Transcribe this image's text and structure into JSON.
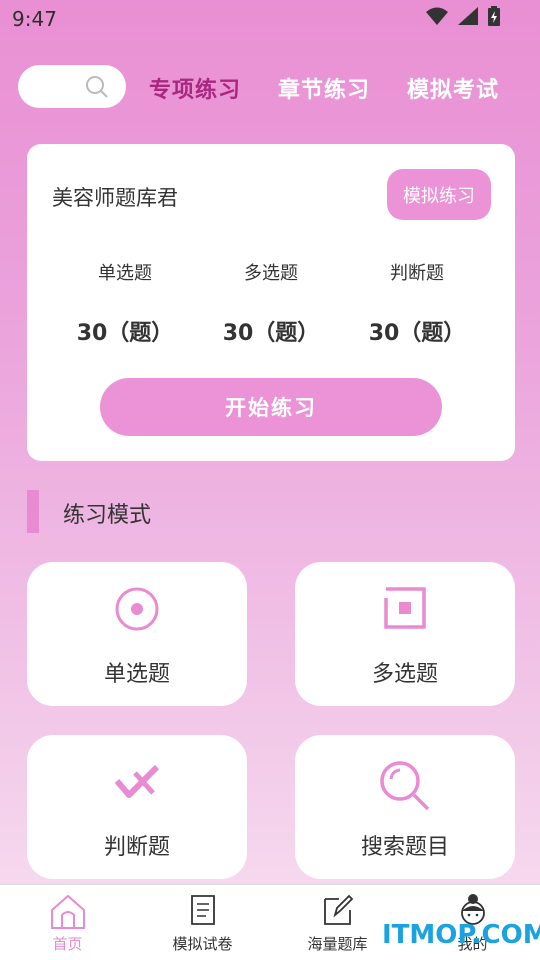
{
  "status_bar": {
    "time": "9:47"
  },
  "search": {
    "icon": "search-icon"
  },
  "top_tabs": [
    {
      "label": "专项练习",
      "active": true
    },
    {
      "label": "章节练习",
      "active": false
    },
    {
      "label": "模拟考试",
      "active": false
    }
  ],
  "card": {
    "title": "美容师题库君",
    "mock_button": "模拟练习",
    "stats": [
      {
        "label": "单选题",
        "value": "30（题）"
      },
      {
        "label": "多选题",
        "value": "30（题）"
      },
      {
        "label": "判断题",
        "value": "30（题）"
      }
    ],
    "start_button": "开始练习"
  },
  "section": {
    "title": "练习模式"
  },
  "modes": [
    {
      "label": "单选题",
      "icon": "radio-icon"
    },
    {
      "label": "多选题",
      "icon": "checkbox-icon"
    },
    {
      "label": "判断题",
      "icon": "check-cross-icon"
    },
    {
      "label": "搜索题目",
      "icon": "search-icon"
    }
  ],
  "bottom_nav": [
    {
      "label": "首页",
      "icon": "home-icon",
      "active": true
    },
    {
      "label": "模拟试卷",
      "icon": "paper-icon",
      "active": false
    },
    {
      "label": "海量题库",
      "icon": "edit-icon",
      "active": false
    },
    {
      "label": "我的",
      "icon": "profile-icon",
      "active": false
    }
  ],
  "watermark": "ITMOP.COM",
  "colors": {
    "accent": "#eb93d6",
    "active_tab": "#a82881",
    "icon": "#e98ad2"
  }
}
